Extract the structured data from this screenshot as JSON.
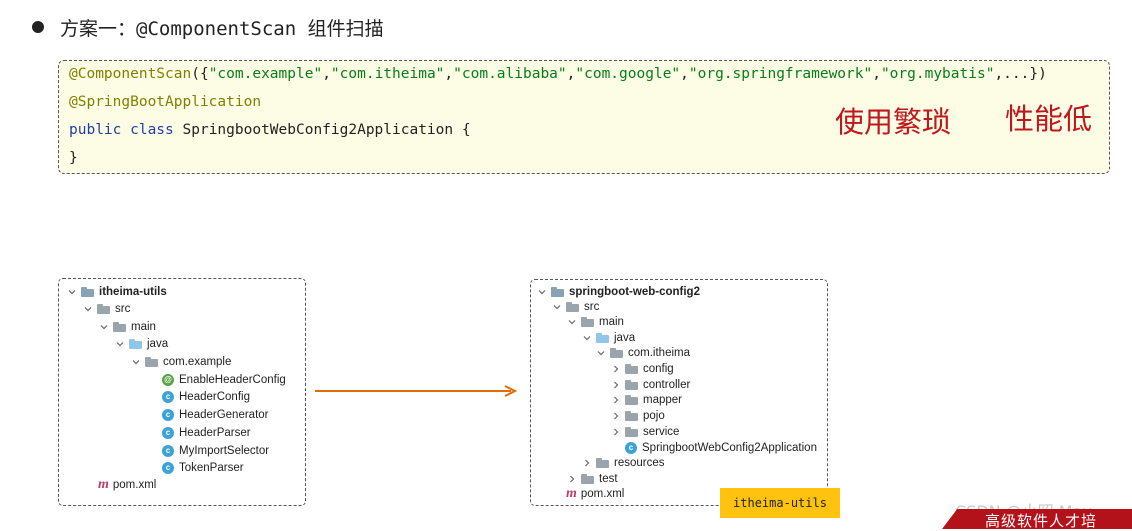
{
  "heading": {
    "text": "方案一：@ComponentScan 组件扫描"
  },
  "code": {
    "line1_anno": "@ComponentScan",
    "line1_open": "({",
    "line1_strings": [
      "\"com.example\"",
      "\"com.itheima\"",
      "\"com.alibaba\"",
      "\"com.google\"",
      "\"org.springframework\"",
      "\"org.mybatis\""
    ],
    "line1_close": ",...})",
    "line2": "@SpringBootApplication",
    "line3_kw": "public class ",
    "line3_rest": "SpringbootWebConfig2Application {",
    "line4": "}"
  },
  "notes": {
    "cumbersome": "使用繁琐",
    "low_perf": "性能低"
  },
  "left_tree": {
    "root": "itheima-utils",
    "src": "src",
    "main": "main",
    "java": "java",
    "package": "com.example",
    "classes": [
      "EnableHeaderConfig",
      "HeaderConfig",
      "HeaderGenerator",
      "HeaderParser",
      "MyImportSelector",
      "TokenParser"
    ],
    "pom": "pom.xml"
  },
  "right_tree": {
    "root": "springboot-web-config2",
    "src": "src",
    "main": "main",
    "java": "java",
    "package": "com.itheima",
    "subpackages": [
      "config",
      "controller",
      "mapper",
      "pojo",
      "service"
    ],
    "app_class": "SpringbootWebConfig2Application",
    "resources": "resources",
    "test": "test",
    "pom": "pom.xml"
  },
  "tag": {
    "text": "itheima-utils"
  },
  "watermark": {
    "text": "CSDN @小昭 May"
  },
  "banner": {
    "text": "高级软件人才培"
  },
  "colors": {
    "accent_red": "#c0171c",
    "arrow_orange": "#e36c09",
    "tag_yellow": "#ffc20e",
    "code_bg": "#fdfde6"
  }
}
